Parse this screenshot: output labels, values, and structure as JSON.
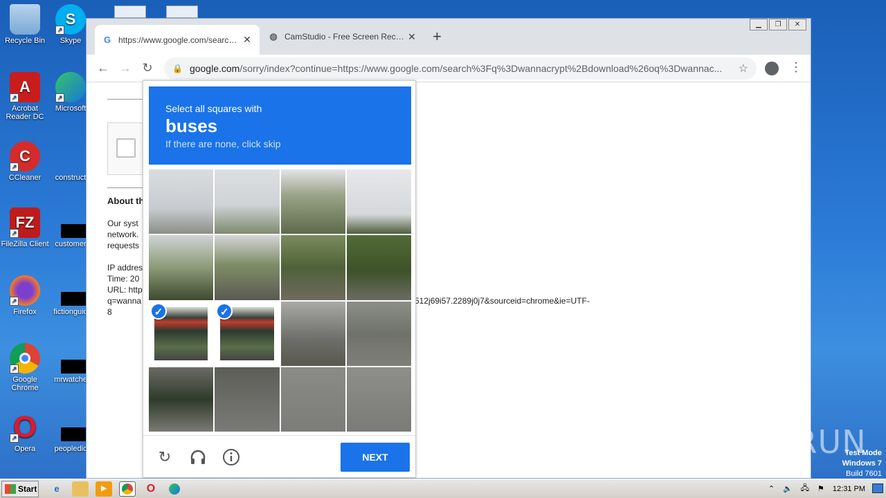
{
  "desktop": {
    "icons": [
      {
        "label": "Recycle Bin"
      },
      {
        "label": "Skype"
      },
      {
        "label": "Acrobat Reader DC"
      },
      {
        "label": "Microsoft"
      },
      {
        "label": "CCleaner"
      },
      {
        "label": "construct"
      },
      {
        "label": "FileZilla Client"
      },
      {
        "label": "customer"
      },
      {
        "label": "Firefox"
      },
      {
        "label": "fictionguid"
      },
      {
        "label": "Google Chrome"
      },
      {
        "label": "mrwatche"
      },
      {
        "label": "Opera"
      },
      {
        "label": "peopledic"
      }
    ]
  },
  "browser": {
    "tabs": [
      {
        "title": "https://www.google.com/search?q=",
        "favicon": "G"
      },
      {
        "title": "CamStudio - Free Screen Recording",
        "favicon": "globe"
      }
    ],
    "omnibox": {
      "host": "google.com",
      "path": "/sorry/index?continue=https://www.google.com/search%3Fq%3Dwannacrypt%2Bdownload%26oq%3Dwannac..."
    }
  },
  "page": {
    "about_heading": "About th",
    "para1": [
      "Our syst",
      "network.",
      "requests"
    ],
    "para2": [
      "IP addres",
      "Time: 20",
      "URL: http",
      "q=wanna",
      "8"
    ],
    "url_tail": "512j69i57.2289j0j7&sourceid=chrome&ie=UTF-"
  },
  "captcha": {
    "instruction": "Select all squares with",
    "target": "buses",
    "hint": "If there are none, click skip",
    "next_label": "NEXT",
    "selected_tiles": [
      8,
      9
    ]
  },
  "overlay": {
    "watermark": "ANY RUN",
    "test_mode": "Test Mode",
    "os": "Windows 7",
    "build": "Build 7601"
  },
  "taskbar": {
    "start_label": "Start",
    "clock": "12:31 PM"
  }
}
